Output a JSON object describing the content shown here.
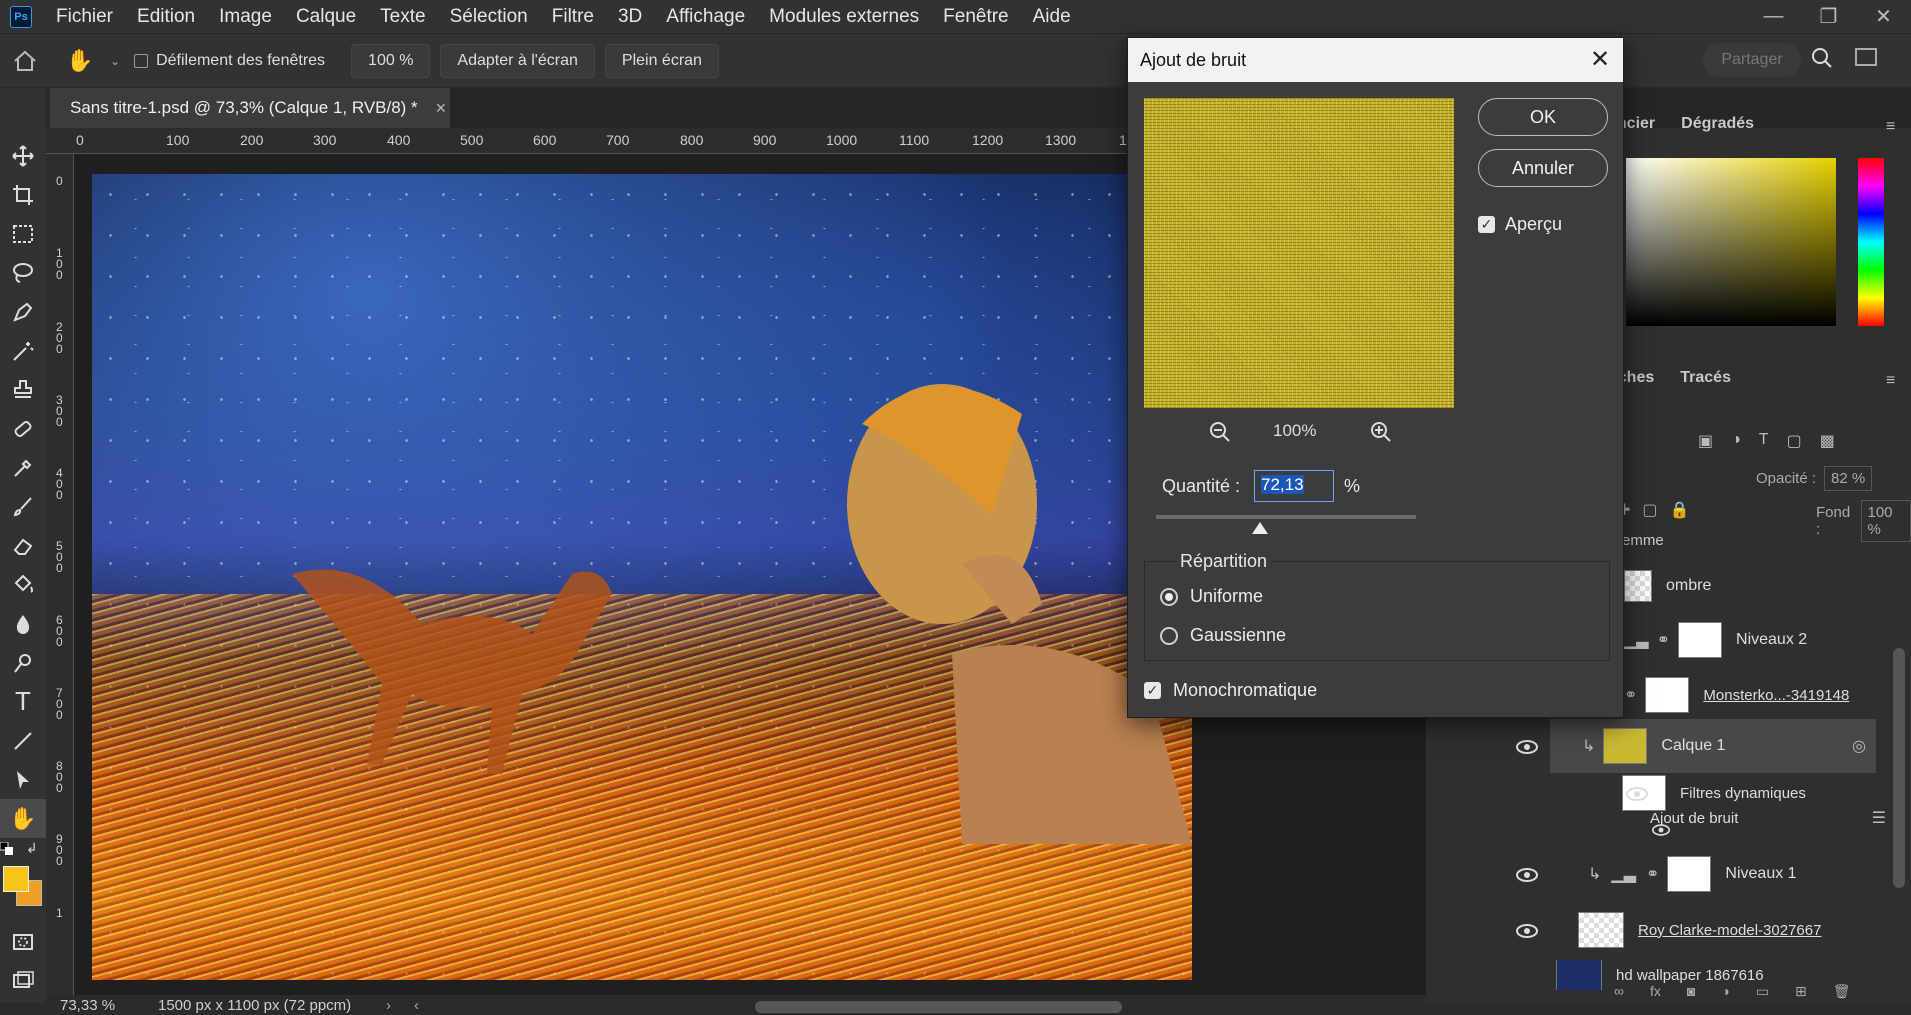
{
  "app": {
    "logo": "Ps",
    "menu": [
      "Fichier",
      "Edition",
      "Image",
      "Calque",
      "Texte",
      "Sélection",
      "Filtre",
      "3D",
      "Affichage",
      "Modules externes",
      "Fenêtre",
      "Aide"
    ]
  },
  "options_bar": {
    "scroll_all_windows_label": "Défilement des fenêtres",
    "zoom_value": "100 %",
    "fit_screen_label": "Adapter à l'écran",
    "full_screen_label": "Plein écran",
    "share_label": "Partager"
  },
  "document": {
    "tab_title": "Sans titre-1.psd @ 73,3% (Calque 1, RVB/8) *"
  },
  "ruler": {
    "top_ticks": [
      "0",
      "100",
      "200",
      "300",
      "400",
      "500",
      "600",
      "700",
      "800",
      "900",
      "1000",
      "1100",
      "1200",
      "1300",
      "1"
    ],
    "left_ticks": [
      "0",
      "1\n0\n0",
      "2\n0\n0",
      "3\n0\n0",
      "4\n0\n0",
      "5\n0\n0",
      "6\n0\n0",
      "7\n0\n0",
      "8\n0\n0",
      "9\n0\n0",
      "1"
    ]
  },
  "status": {
    "zoom": "73,33 %",
    "doc_size": "1500 px x 1100 px (72 ppcm)"
  },
  "colors": {
    "foreground": "#f5c518",
    "background": "#f0a020",
    "accent": "#1473e6"
  },
  "panels": {
    "top_tabs": [
      "ancier",
      "Dégradés"
    ],
    "layers_tabs": [
      "uches",
      "Tracés"
    ],
    "opacity_label": "Opacité :",
    "opacity_value": "82 %",
    "fill_label": "Fond :",
    "fill_value": "100 %",
    "group_partial_label": "emme"
  },
  "layers": [
    {
      "name": "ombre",
      "type": "pixel"
    },
    {
      "name": "Niveaux 2",
      "type": "adjustment"
    },
    {
      "name": "Monsterko...-3419148",
      "type": "smart"
    },
    {
      "name": "Calque 1",
      "type": "smart",
      "selected": true
    },
    {
      "name": "Filtres dynamiques",
      "type": "filter-mask"
    },
    {
      "name": "Ajout de bruit",
      "type": "filter"
    },
    {
      "name": "Niveaux 1",
      "type": "adjustment"
    },
    {
      "name": "Roy Clarke-model-3027667",
      "type": "smart"
    },
    {
      "name": "hd wallpaper 1867616",
      "type": "pixel"
    }
  ],
  "dialog": {
    "title": "Ajout de bruit",
    "ok_label": "OK",
    "cancel_label": "Annuler",
    "preview_label": "Aperçu",
    "preview_checked": true,
    "zoom_level": "100%",
    "amount_label": "Quantité :",
    "amount_value": "72,13",
    "amount_unit": "%",
    "amount_slider_fraction": 0.4,
    "distribution_label": "Répartition",
    "uniform_label": "Uniforme",
    "gaussian_label": "Gaussienne",
    "distribution_selected": "Uniforme",
    "monochrome_label": "Monochromatique",
    "monochrome_checked": true
  }
}
